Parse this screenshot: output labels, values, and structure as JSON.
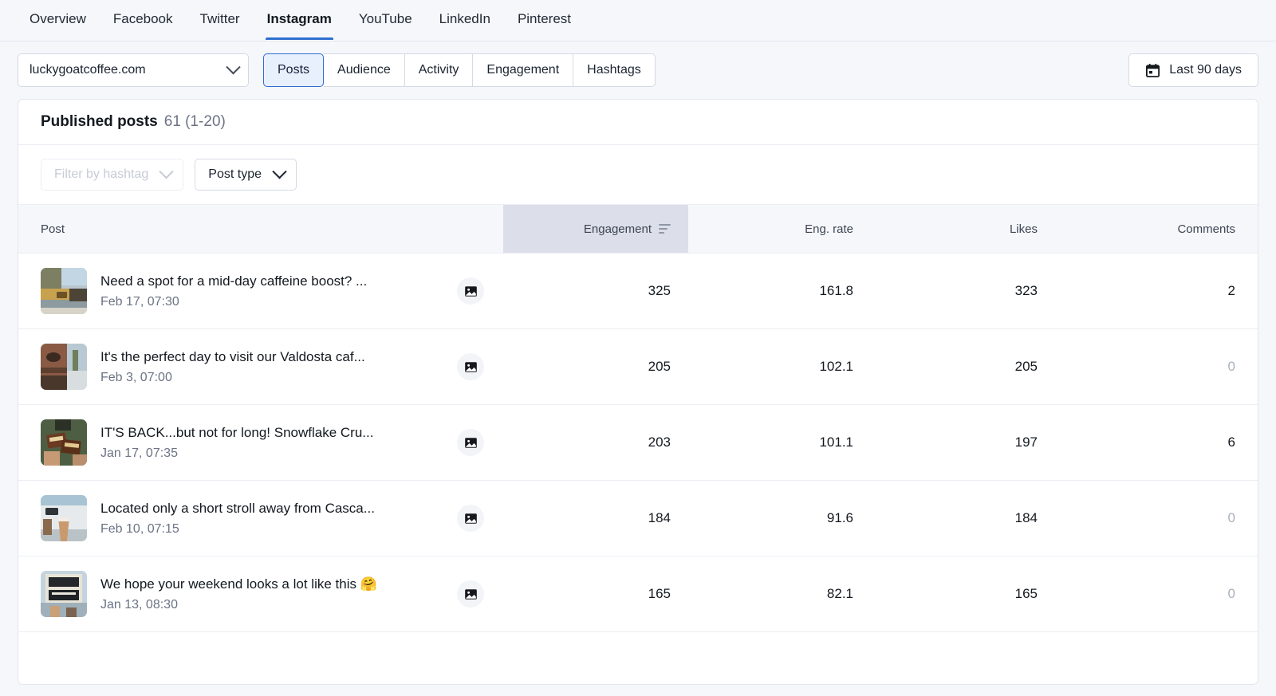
{
  "topnav": {
    "items": [
      {
        "label": "Overview",
        "active": false
      },
      {
        "label": "Facebook",
        "active": false
      },
      {
        "label": "Twitter",
        "active": false
      },
      {
        "label": "Instagram",
        "active": true
      },
      {
        "label": "YouTube",
        "active": false
      },
      {
        "label": "LinkedIn",
        "active": false
      },
      {
        "label": "Pinterest",
        "active": false
      }
    ]
  },
  "toolbar": {
    "domain": "luckygoatcoffee.com",
    "domain_icon": "chevron-down-icon",
    "segments": [
      {
        "label": "Posts",
        "active": true
      },
      {
        "label": "Audience",
        "active": false
      },
      {
        "label": "Activity",
        "active": false
      },
      {
        "label": "Engagement",
        "active": false
      },
      {
        "label": "Hashtags",
        "active": false
      }
    ],
    "date_range": {
      "label": "Last 90 days",
      "icon": "calendar-icon"
    }
  },
  "card": {
    "title": "Published posts",
    "count": "61 (1-20)",
    "filters": [
      {
        "label": "Filter by hashtag",
        "icon": "chevron-down-icon",
        "disabled": true
      },
      {
        "label": "Post type",
        "icon": "chevron-down-icon",
        "disabled": false
      }
    ]
  },
  "table": {
    "columns": {
      "post": "Post",
      "engagement": "Engagement",
      "eng_rate": "Eng. rate",
      "likes": "Likes",
      "comments": "Comments"
    },
    "sort": {
      "column": "Engagement",
      "icon": "sort-descending-icon"
    },
    "rows": [
      {
        "title": "Need a spot for a mid-day caffeine boost? ...",
        "date": "Feb 17, 07:30",
        "type_icon": "image-icon",
        "thumb": "cafe-storefront-awning",
        "engagement": "325",
        "eng_rate": "161.8",
        "likes": "323",
        "comments": "2"
      },
      {
        "title": "It's the perfect day to visit our Valdosta caf...",
        "date": "Feb 3, 07:00",
        "type_icon": "image-icon",
        "thumb": "brick-storefront-street",
        "engagement": "205",
        "eng_rate": "102.1",
        "likes": "205",
        "comments": "0"
      },
      {
        "title": "IT'S BACK...but not for long! Snowflake Cru...",
        "date": "Jan 17, 07:35",
        "type_icon": "image-icon",
        "thumb": "hands-holding-chocolate-bars",
        "engagement": "203",
        "eng_rate": "101.1",
        "likes": "197",
        "comments": "6"
      },
      {
        "title": "Located only a short stroll away from Casca...",
        "date": "Feb 10, 07:15",
        "type_icon": "image-icon",
        "thumb": "hand-holding-iced-coffee",
        "engagement": "184",
        "eng_rate": "91.6",
        "likes": "184",
        "comments": "0"
      },
      {
        "title": "We hope your weekend looks a lot like this 🤗",
        "date": "Jan 13, 08:30",
        "type_icon": "image-icon",
        "thumb": "coffee-shop-sign-board",
        "engagement": "165",
        "eng_rate": "82.1",
        "likes": "165",
        "comments": "0"
      }
    ]
  },
  "colors": {
    "accent": "#2f6ed0",
    "accent_bg": "#e8f0fd",
    "page_bg": "#f5f7fa",
    "header_sorted_bg": "#dcdfe9",
    "text": "#14191f",
    "muted": "#6b7384"
  }
}
